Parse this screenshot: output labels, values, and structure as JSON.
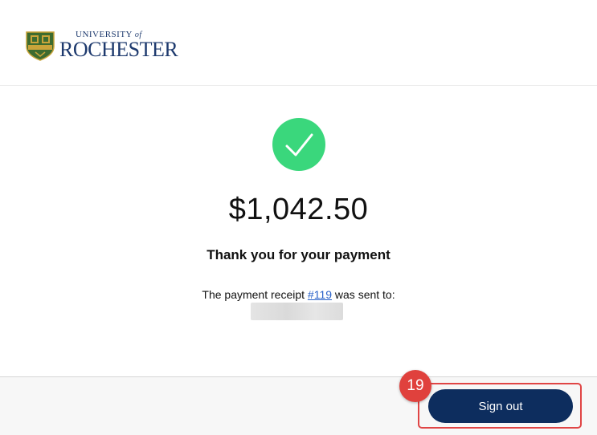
{
  "header": {
    "logo": {
      "top_text": "UNIVERSITY",
      "of_text": "of",
      "main_text": "ROCHESTER",
      "shield_motto": "MELIORA",
      "colors": {
        "navy": "#1e3a6e",
        "green": "#3d6b2f",
        "gold": "#c9a43a"
      }
    }
  },
  "confirmation": {
    "amount": "$1,042.50",
    "message": "Thank you for your payment",
    "receipt_prefix": "The payment receipt ",
    "receipt_link": "#119",
    "receipt_suffix": " was sent to:",
    "success_color": "#3ad77c"
  },
  "footer": {
    "signout_label": "Sign out",
    "step_badge": "19",
    "button_color": "#0d2d5e",
    "highlight_color": "#e04545"
  }
}
